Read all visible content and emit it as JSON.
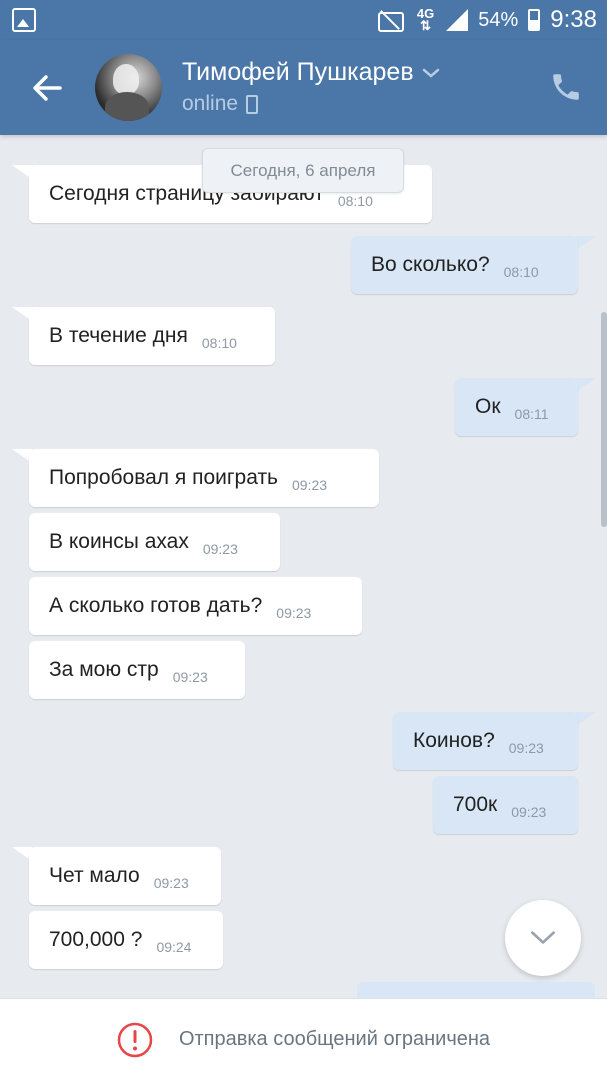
{
  "status_bar": {
    "network": "4G",
    "battery": "54%",
    "time": "9:38"
  },
  "header": {
    "contact_name": "Тимофей Пушкарев",
    "status": "online"
  },
  "date_separator": "Сегодня, 6 апреля",
  "messages": [
    {
      "direction": "in",
      "text": "Сегодня страницу забирают",
      "time": "08:10"
    },
    {
      "direction": "out",
      "text": "Во сколько?",
      "time": "08:10"
    },
    {
      "direction": "in",
      "text": "В течение дня",
      "time": "08:10"
    },
    {
      "direction": "out",
      "text": "Ок",
      "time": "08:11"
    },
    {
      "direction": "in",
      "text": "Попробовал я поиграть",
      "time": "09:23"
    },
    {
      "direction": "in",
      "text": "В коинсы ахах",
      "time": "09:23"
    },
    {
      "direction": "in",
      "text": "А сколько готов дать?",
      "time": "09:23"
    },
    {
      "direction": "in",
      "text": "За мою стр",
      "time": "09:23"
    },
    {
      "direction": "out",
      "text": "Коинов?",
      "time": "09:23"
    },
    {
      "direction": "out",
      "text": "700к",
      "time": "09:23"
    },
    {
      "direction": "in",
      "text": "Чет мало",
      "time": "09:23"
    },
    {
      "direction": "in",
      "text": "700,000 ?",
      "time": "09:24"
    }
  ],
  "footer": {
    "notice": "Отправка сообщений ограничена"
  },
  "colors": {
    "header": "#4a76a8",
    "background": "#e7ebf0",
    "incoming_bubble": "#ffffff",
    "outgoing_bubble": "#d8e6f6",
    "error": "#e64646"
  }
}
